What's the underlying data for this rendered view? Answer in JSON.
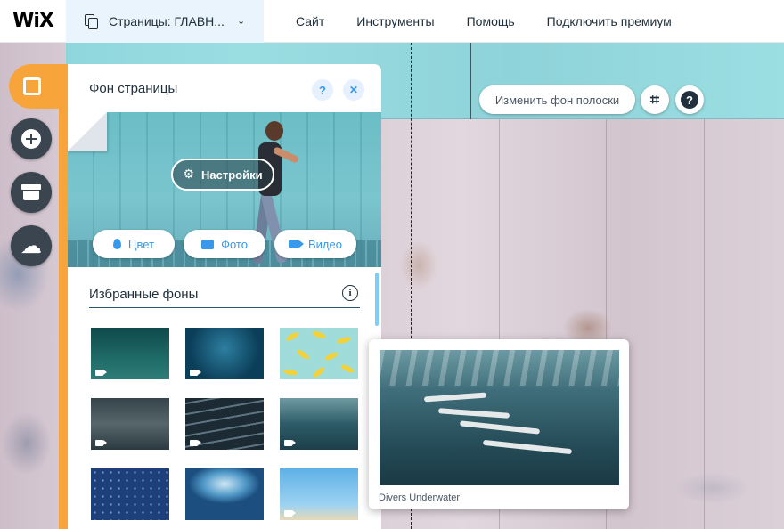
{
  "topbar": {
    "logo": "WiX",
    "pages_label": "Страницы: ГЛАВН...",
    "menu": [
      "Сайт",
      "Инструменты",
      "Помощь",
      "Подключить премиум"
    ]
  },
  "strip": {
    "change_bg_label": "Изменить фон полоски",
    "crop_icon": "crop-icon",
    "help_icon": "help-icon"
  },
  "panel": {
    "title": "Фон страницы",
    "help_symbol": "?",
    "close_symbol": "✕",
    "settings_label": "Настройки",
    "media_buttons": [
      "Цвет",
      "Фото",
      "Видео"
    ],
    "section_title": "Избранные фоны",
    "info_symbol": "i"
  },
  "hover_preview": {
    "caption": "Divers Underwater"
  },
  "colors": {
    "accent": "#3899ec",
    "rail_orange": "#f7a43a",
    "rail_button": "#3b4550"
  }
}
